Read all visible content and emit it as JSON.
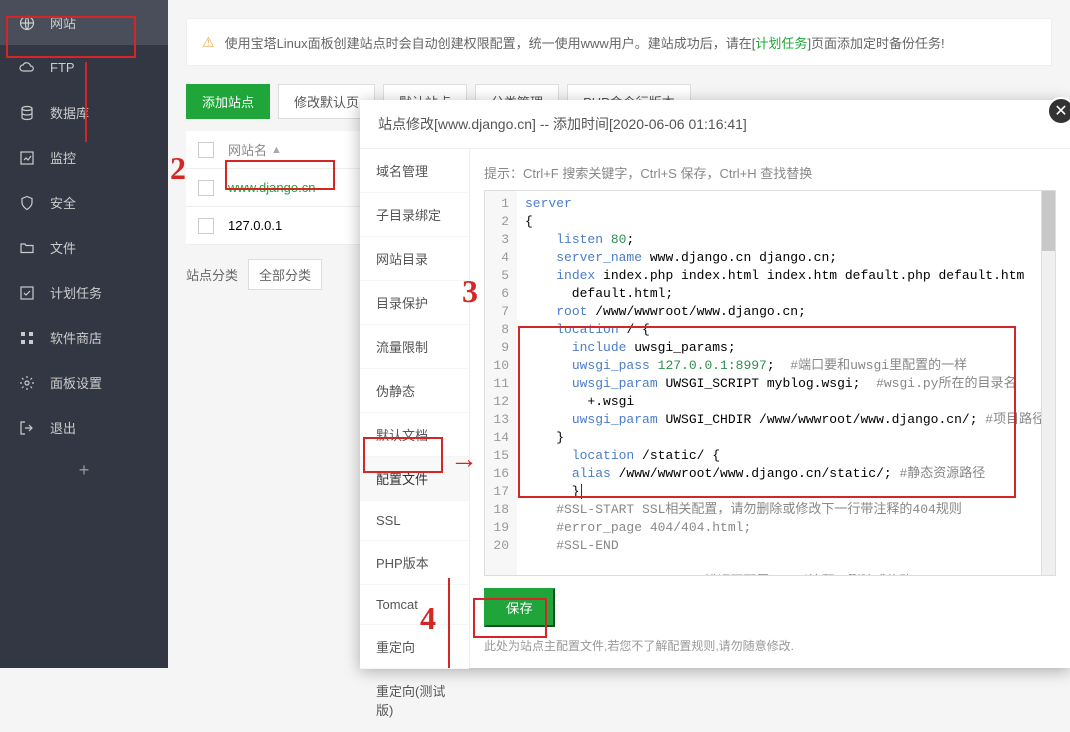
{
  "sidebar": {
    "items": [
      {
        "label": "网站",
        "icon": "globe"
      },
      {
        "label": "FTP",
        "icon": "cloud"
      },
      {
        "label": "数据库",
        "icon": "database"
      },
      {
        "label": "监控",
        "icon": "chart"
      },
      {
        "label": "安全",
        "icon": "shield"
      },
      {
        "label": "文件",
        "icon": "folder"
      },
      {
        "label": "计划任务",
        "icon": "check"
      },
      {
        "label": "软件商店",
        "icon": "grid"
      },
      {
        "label": "面板设置",
        "icon": "gear"
      },
      {
        "label": "退出",
        "icon": "exit"
      }
    ]
  },
  "alert": {
    "text_pre": "使用宝塔Linux面板创建站点时会自动创建权限配置，统一使用www用户。建站成功后，请在[",
    "link": "计划任务",
    "text_post": "]页面添加定时备份任务!"
  },
  "toolbar": {
    "add": "添加站点",
    "modify": "修改默认页",
    "default": "默认站点",
    "category": "分类管理",
    "php": "PHP命令行版本"
  },
  "table": {
    "header_site": "网站名",
    "rows": [
      {
        "site": "www.django.cn"
      },
      {
        "site": "127.0.0.1"
      }
    ]
  },
  "filter": {
    "label": "站点分类",
    "option": "全部分类"
  },
  "dialog": {
    "title": "站点修改[www.django.cn] -- 添加时间[2020-06-06 01:16:41]",
    "tabs": [
      "域名管理",
      "子目录绑定",
      "网站目录",
      "目录保护",
      "流量限制",
      "伪静态",
      "默认文档",
      "配置文件",
      "SSL",
      "PHP版本",
      "Tomcat",
      "重定向",
      "重定向(测试版)"
    ],
    "active_tab": 7,
    "hint": "提示：Ctrl+F 搜索关键字，Ctrl+S 保存，Ctrl+H 查找替换",
    "save": "保存",
    "tip": "此处为站点主配置文件,若您不了解配置规则,请勿随意修改."
  },
  "code_lines": [
    {
      "n": 1,
      "html": "<span class='kw'>server</span>"
    },
    {
      "n": 2,
      "html": "{"
    },
    {
      "n": 3,
      "html": "    <span class='dir'>listen</span> <span class='num'>80</span>;"
    },
    {
      "n": 4,
      "html": "    <span class='dir'>server_name</span> www.django.cn django.cn;"
    },
    {
      "n": 5,
      "html": "    <span class='dir'>index</span> index.php index.html index.htm default.php default.htm\n      default.html;"
    },
    {
      "n": 6,
      "html": "    <span class='dir'>root</span> /www/wwwroot/www.django.cn;"
    },
    {
      "n": 7,
      "html": "    <span class='dir'>location</span> / {"
    },
    {
      "n": 8,
      "html": "      <span class='dir'>include</span> uwsgi_params;"
    },
    {
      "n": 9,
      "html": "      <span class='dir'>uwsgi_pass</span> <span class='num'>127.0.0.1:8997</span>;  <span class='com'>#端口要和uwsgi里配置的一样</span>"
    },
    {
      "n": 10,
      "html": "      <span class='dir'>uwsgi_param</span> UWSGI_SCRIPT myblog.wsgi;  <span class='com'>#wsgi.py所在的目录名\n        +.wsgi</span>"
    },
    {
      "n": 11,
      "html": "      <span class='dir'>uwsgi_param</span> UWSGI_CHDIR /www/wwwroot/www.django.cn/; <span class='com'>#项目路径</span>"
    },
    {
      "n": 12,
      "html": "    }"
    },
    {
      "n": 13,
      "html": "      <span class='dir'>location</span> /static/ {"
    },
    {
      "n": 14,
      "html": "      <span class='dir'>alias</span> /www/wwwroot/www.django.cn/static/; <span class='com'>#静态资源路径</span>"
    },
    {
      "n": 15,
      "html": "      }<span style='border-left:1px solid #333;margin-left:1px;'></span>"
    },
    {
      "n": 16,
      "html": "    <span class='com'>#SSL-START SSL相关配置，请勿删除或修改下一行带注释的404规则</span>"
    },
    {
      "n": 17,
      "html": "    <span class='com'>#error_page 404/404.html;</span>"
    },
    {
      "n": 18,
      "html": "    <span class='com'>#SSL-END</span>"
    },
    {
      "n": 19,
      "html": ""
    },
    {
      "n": 20,
      "html": "    <span class='com'>#ERROR-PAGE-START  错误页配置，可以注释、删除或修改</span>"
    }
  ]
}
